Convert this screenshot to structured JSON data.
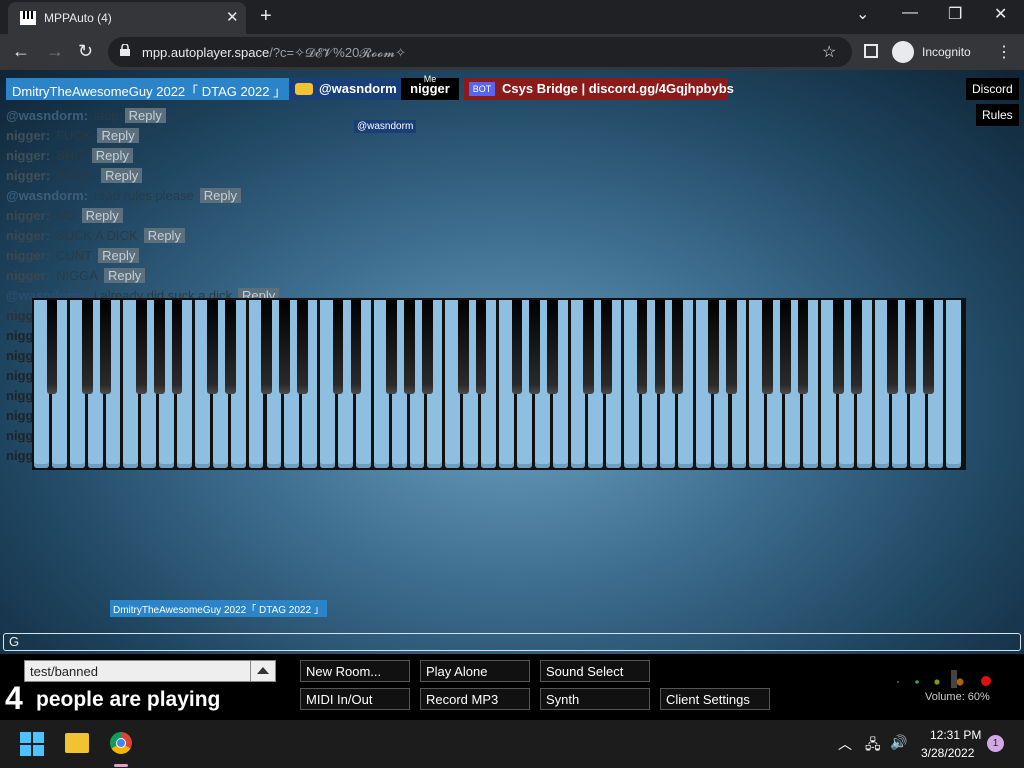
{
  "browser": {
    "tab_title": "MPPAuto (4)",
    "url_host": "mpp.autoplayer.space",
    "url_path": "/?c=✧𝓓𝓔𝓥%20𝓡𝓸𝓸𝓶✧",
    "incognito_label": "Incognito"
  },
  "users": [
    {
      "name": "DmitryTheAwesomeGuy 2022「 DTAG 2022 」"
    },
    {
      "name": "@wasndorm"
    },
    {
      "name": "nigger",
      "tag": "Me"
    },
    {
      "name": "Csys Bridge | discord.gg/4Gqjhpbybs",
      "tag": "BOT"
    }
  ],
  "top_buttons": {
    "discord": "Discord",
    "rules": "Rules"
  },
  "tooltips": {
    "hover_user": "@wasndorm",
    "hover_reply": "DmitryTheAwesomeGuy 2022「 DTAG 2022 」"
  },
  "chat": {
    "reply_label": "Reply",
    "messages": [
      {
        "nick": "@wasndorm:",
        "text": "stop",
        "color": "#3d5f7a"
      },
      {
        "nick": "nigger:",
        "text": "FUCK",
        "color": "#405058"
      },
      {
        "nick": "nigger:",
        "text": "SHIT",
        "color": "#405058"
      },
      {
        "nick": "nigger:",
        "text": "BITCH",
        "color": "#405058"
      },
      {
        "nick": "@wasndorm:",
        "text": "read rules please",
        "color": "#3d5f7a"
      },
      {
        "nick": "nigger:",
        "text": "NO",
        "color": "#3a4850"
      },
      {
        "nick": "nigger:",
        "text": "SUCK A DICK",
        "color": "#3a4850"
      },
      {
        "nick": "nigger:",
        "text": "CUNT",
        "color": "#3a4850"
      },
      {
        "nick": "nigger:",
        "text": "NIGGA",
        "color": "#3a4850"
      },
      {
        "nick": "@wasndorm:",
        "text": "i already did suck a dick",
        "color": "#2d4d70"
      },
      {
        "nick": "nigger:",
        "text": "GDF",
        "color": "#2a3238"
      },
      {
        "nick": "nigger:",
        "text": "GD",
        "color": "#1e2428"
      },
      {
        "nick": "nigger:",
        "text": "DF",
        "color": "#1e2428"
      },
      {
        "nick": "nigger:",
        "text": "DG",
        "color": "#1e2428"
      },
      {
        "nick": "nigger:",
        "text": "GFD",
        "color": "#1e2428"
      },
      {
        "nick": "nigger:",
        "text": "G",
        "color": "#1e2428"
      },
      {
        "nick": "nigger:",
        "text": "DF",
        "color": "#1e2428"
      },
      {
        "nick": "nigger:",
        "text": "GG",
        "color": "#1e2428"
      }
    ],
    "input_value": "G"
  },
  "bottom": {
    "room": "test/banned",
    "player_count": "4",
    "player_label": "people are playing",
    "buttons": [
      "New Room...",
      "Play Alone",
      "Sound Select",
      "MIDI In/Out",
      "Record MP3",
      "Synth",
      "Client Settings"
    ],
    "volume": "Volume: 60%"
  },
  "taskbar": {
    "time": "12:31 PM",
    "date": "3/28/2022",
    "notifications": "1"
  },
  "colors": {
    "piano_white": "#8fbfe0",
    "room_bg_center": "#6b9fc0",
    "bot_tag": "#5865f2"
  }
}
